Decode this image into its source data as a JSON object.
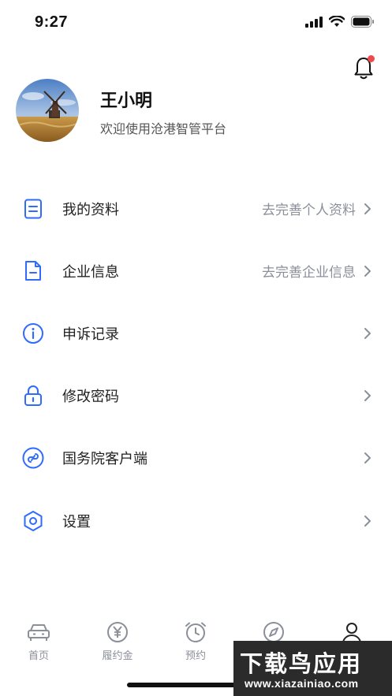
{
  "status_bar": {
    "time": "9:27"
  },
  "profile": {
    "name": "王小明",
    "subtitle": "欢迎使用沧港智管平台"
  },
  "menu": [
    {
      "icon": "document-icon",
      "label": "我的资料",
      "hint": "去完善个人资料"
    },
    {
      "icon": "file-minus-icon",
      "label": "企业信息",
      "hint": "去完善企业信息"
    },
    {
      "icon": "info-icon",
      "label": "申诉记录",
      "hint": ""
    },
    {
      "icon": "lock-icon",
      "label": "修改密码",
      "hint": ""
    },
    {
      "icon": "link-icon",
      "label": "国务院客户端",
      "hint": ""
    },
    {
      "icon": "settings-hexagon-icon",
      "label": "设置",
      "hint": ""
    }
  ],
  "tabbar": [
    {
      "icon": "car-icon",
      "label": "首页"
    },
    {
      "icon": "yen-icon",
      "label": "履约金"
    },
    {
      "icon": "alarm-clock-icon",
      "label": "预约"
    },
    {
      "icon": "compass-icon",
      "label": ""
    },
    {
      "icon": "user-icon",
      "label": ""
    }
  ],
  "watermark": {
    "title": "下载鸟应用",
    "url": "www.xiazainiao.com"
  },
  "colors": {
    "accent": "#2f6bff",
    "hint": "#8a8f99",
    "badge": "#f24a4a"
  }
}
